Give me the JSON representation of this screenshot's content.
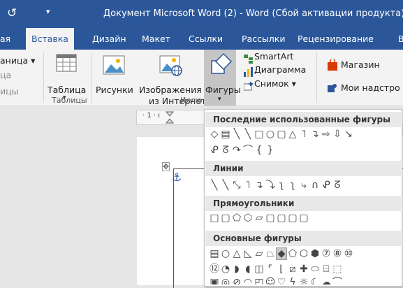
{
  "titlebar": {
    "undo_glyph": "↺",
    "qat_glyph": "▾",
    "title": "Документ Microsoft Word (2) - Word (Сбой активации продукта)"
  },
  "tabs": [
    {
      "label": "ая"
    },
    {
      "label": "Вставка"
    },
    {
      "label": "Дизайн"
    },
    {
      "label": "Макет"
    },
    {
      "label": "Ссылки"
    },
    {
      "label": "Рассылки"
    },
    {
      "label": "Рецензирование"
    },
    {
      "label": "В"
    }
  ],
  "ribbon": {
    "page_label": "аница ▾",
    "cut1": "ца",
    "cut2": "ицы",
    "table_label": "Таблица",
    "table_arrow": "▾",
    "pictures_label": "Рисунки",
    "online_label_1": "Изображения",
    "online_label_2": "из Интернета",
    "shapes_label": "Фигуры",
    "shapes_arrow": "▾",
    "smartart_label": "SmartArt",
    "chart_label": "Диаграмма",
    "screenshot_label": "Снимок ▾",
    "store_label": "Магазин",
    "addins_label": "Мои надстро",
    "group_tables": "Таблицы",
    "group_illustrations": "Иллю"
  },
  "ruler": {
    "text": "· 1 · ı"
  },
  "anchor_glyph": "⚓",
  "move_handle_glyph": "✥",
  "gallery": {
    "sections": [
      {
        "title": "Последние использованные фигуры"
      },
      {
        "title": "Линии"
      },
      {
        "title": "Прямоугольники"
      },
      {
        "title": "Основные фигуры"
      }
    ]
  },
  "colors": {
    "accent": "#2b579a",
    "ribbon_bg": "#f3f3f3"
  }
}
